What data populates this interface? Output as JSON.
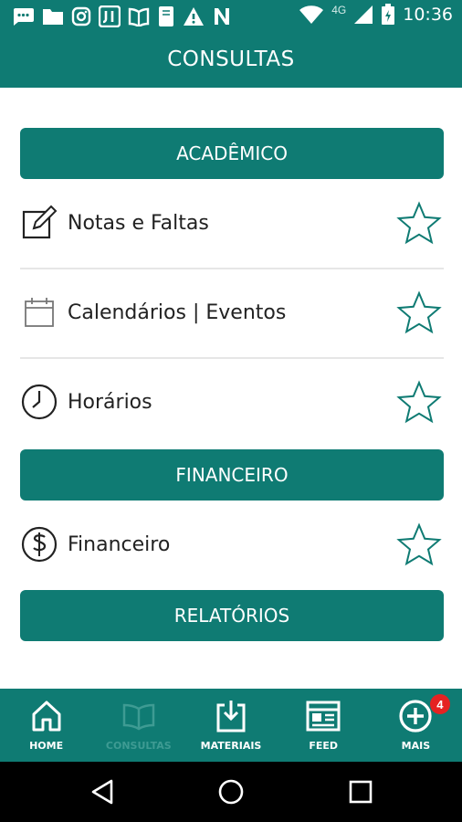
{
  "status_bar": {
    "time": "10:36",
    "network": "4G",
    "icons": [
      "chat-icon",
      "folder-icon",
      "instagram-icon",
      "app-icon",
      "book-icon",
      "document-icon",
      "warning-icon",
      "n-icon",
      "wifi-icon",
      "signal-icon",
      "battery-icon"
    ]
  },
  "app_bar": {
    "title": "CONSULTAS"
  },
  "sections": [
    {
      "header": "ACADÊMICO",
      "items": [
        {
          "label": "Notas e Faltas",
          "icon": "edit-icon"
        },
        {
          "label": "Calendários | Eventos",
          "icon": "calendar-icon"
        },
        {
          "label": "Horários",
          "icon": "clock-icon"
        }
      ]
    },
    {
      "header": "FINANCEIRO",
      "items": [
        {
          "label": "Financeiro",
          "icon": "dollar-icon"
        }
      ]
    },
    {
      "header": "RELATÓRIOS",
      "items": []
    }
  ],
  "bottom_nav": {
    "items": [
      {
        "label": "HOME",
        "icon": "home-icon",
        "active": true
      },
      {
        "label": "CONSULTAS",
        "icon": "book-icon",
        "active": false
      },
      {
        "label": "MATERIAIS",
        "icon": "download-icon",
        "active": true
      },
      {
        "label": "FEED",
        "icon": "news-icon",
        "active": true
      },
      {
        "label": "MAIS",
        "icon": "plus-circle-icon",
        "active": true,
        "badge": "4"
      }
    ]
  },
  "system_nav": [
    "back-icon",
    "home-circle-icon",
    "recents-icon"
  ],
  "colors": {
    "primary": "#0f7b73",
    "badge": "#e52222",
    "inactive_nav": "#3e9b93"
  }
}
